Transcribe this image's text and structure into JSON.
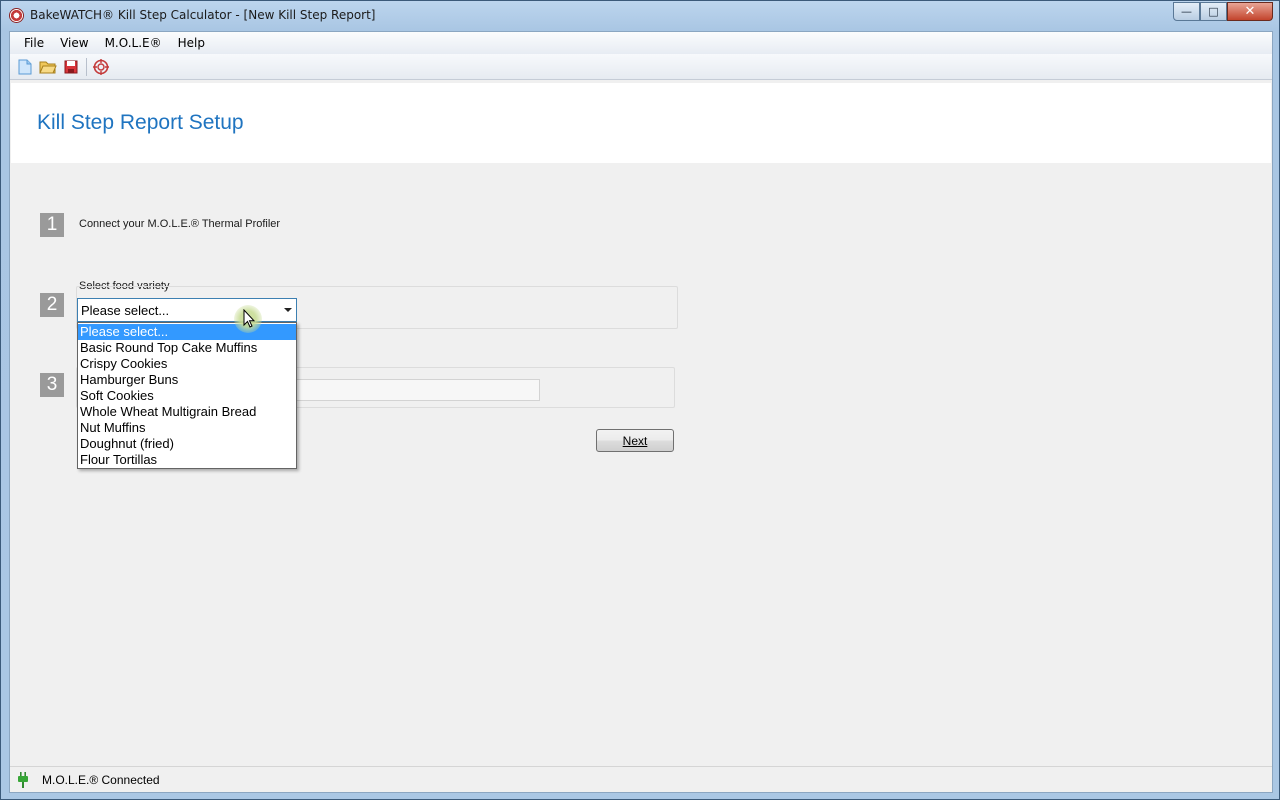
{
  "window": {
    "title": "BakeWATCH® Kill Step Calculator - [New Kill Step Report]",
    "caption_buttons": {
      "minimize": "—",
      "maximize": "□",
      "close": "✕"
    }
  },
  "menu": {
    "items": [
      {
        "label": "File"
      },
      {
        "label": "View"
      },
      {
        "label": "M.O.L.E®"
      },
      {
        "label": "Help"
      }
    ]
  },
  "toolbar": {
    "icons": [
      "new-document-icon",
      "open-folder-icon",
      "save-icon",
      "mole-target-icon"
    ]
  },
  "page": {
    "title": "Kill Step Report Setup"
  },
  "steps": {
    "one": {
      "number": "1",
      "text": "Connect your M.O.L.E.® Thermal Profiler"
    },
    "two": {
      "number": "2",
      "label": "Select food variety"
    },
    "three": {
      "number": "3"
    }
  },
  "food_select": {
    "selected": "Please select...",
    "options": [
      "Please select...",
      "Basic Round Top Cake Muffins",
      "Crispy Cookies",
      "Hamburger Buns",
      "Soft Cookies",
      "Whole Wheat Multigrain Bread",
      "Nut Muffins",
      "Doughnut (fried)",
      "Flour Tortillas"
    ]
  },
  "buttons": {
    "next": "Next"
  },
  "status": {
    "text": "M.O.L.E.® Connected",
    "icon": "plug-connected-icon"
  },
  "colors": {
    "title_blue": "#1f74c0",
    "selection_blue": "#3399ff",
    "step_gray": "#9a9a9a"
  }
}
